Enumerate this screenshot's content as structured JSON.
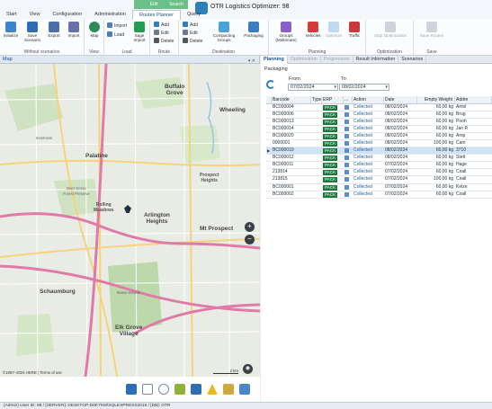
{
  "app": {
    "title": "OTR Logistics Optimizer: 98",
    "context_groups": [
      "Edit",
      "Routes Planner",
      "Search",
      "Query"
    ]
  },
  "tabs": [
    "Start",
    "View",
    "Configuration",
    "Administration",
    "Routes Planner",
    "Query"
  ],
  "active_tab": "Routes Planner",
  "ribbon": {
    "groups": [
      {
        "label": "Without scenarios",
        "buttons": [
          "Initialize",
          "Save Scenario",
          "Export",
          "Import"
        ]
      },
      {
        "label": "View",
        "buttons": [
          "Map"
        ]
      },
      {
        "label": "Load",
        "small": [
          "Import",
          "Load"
        ],
        "buttons": [
          "Sage Import"
        ]
      },
      {
        "label": "Route",
        "small": [
          "Add",
          "Edit",
          "Delete"
        ]
      },
      {
        "label": "Destination",
        "small": [
          "Add",
          "Edit",
          "Delete"
        ],
        "buttons": [
          "Compacting Groups",
          "Packaging"
        ]
      },
      {
        "label": "Planning",
        "buttons": [
          "Groups (Multiroute)",
          "Vehicles",
          "Optimize",
          "Traffic"
        ]
      },
      {
        "label": "Optimization",
        "buttons": [
          "Stop Optimization"
        ]
      },
      {
        "label": "Save",
        "buttons": [
          "Save Routes"
        ]
      }
    ]
  },
  "map": {
    "panel_title": "Map",
    "labels": [
      {
        "text": "Buffalo\nGrove",
        "kind": "big"
      },
      {
        "text": "Wheeling",
        "kind": "big"
      },
      {
        "text": "Inverness",
        "kind": "small"
      },
      {
        "text": "Palatine",
        "kind": "big"
      },
      {
        "text": "Prospect\nHeights",
        "kind": "normal"
      },
      {
        "text": "Rolling\nMeadows",
        "kind": "normal"
      },
      {
        "text": "Arlington\nHeights",
        "kind": "big"
      },
      {
        "text": "Mt Prospect",
        "kind": "big"
      },
      {
        "text": "Schaumburg",
        "kind": "big"
      },
      {
        "text": "Elk Grove\nVillage",
        "kind": "big"
      },
      {
        "text": "Deer Grove\nForest Preserve",
        "kind": "small"
      },
      {
        "text": "Busse Woods",
        "kind": "small"
      }
    ],
    "copyright": "©1987–2024 HERE | Terms of use",
    "scale": "2 km",
    "zoom_in": "+",
    "zoom_out": "−"
  },
  "right": {
    "tabs": [
      "Planning",
      "Optimization",
      "Progression",
      "Result Information",
      "Scenarios"
    ],
    "active_tab": "Planning",
    "section_title": "Packaging",
    "from_label": "From",
    "to_label": "To",
    "from_value": "07/02/2024",
    "to_value": "08/02/2024",
    "columns": [
      "Barcode",
      "Type",
      "ERP",
      "...",
      "Action",
      "Date",
      "Empty Weight",
      "Addre"
    ],
    "rows": [
      {
        "barcode": "BC000004",
        "erp": "PACK",
        "action": "Collected",
        "date": "08/02/2024",
        "weight": "60,00 kg",
        "address": "Amol",
        "selected": false
      },
      {
        "barcode": "BC000006",
        "erp": "PACK",
        "action": "Collected",
        "date": "08/02/2024",
        "weight": "60,00 kg",
        "address": "Brug",
        "selected": false
      },
      {
        "barcode": "BC000013",
        "erp": "PACK",
        "action": "Collected",
        "date": "08/02/2024",
        "weight": "60,00 kg",
        "address": "Pooh",
        "selected": false
      },
      {
        "barcode": "BC000014",
        "erp": "PACK",
        "action": "Collected",
        "date": "08/02/2024",
        "weight": "60,00 kg",
        "address": "Jan R",
        "selected": false
      },
      {
        "barcode": "BC000020",
        "erp": "PACK",
        "action": "Collected",
        "date": "08/02/2024",
        "weight": "60,00 kg",
        "address": "Amp",
        "selected": false
      },
      {
        "barcode": "0000001",
        "erp": "PACK",
        "action": "Collected",
        "date": "08/02/2024",
        "weight": "100,00 kg",
        "address": "Cam",
        "selected": false
      },
      {
        "barcode": "BC000010",
        "erp": "PACK",
        "action": "Collected",
        "date": "08/02/2024",
        "weight": "60,00 kg",
        "address": "3710",
        "selected": true
      },
      {
        "barcode": "BC000012",
        "erp": "PACK",
        "action": "Collected",
        "date": "08/02/2024",
        "weight": "60,00 kg",
        "address": "Stett",
        "selected": false
      },
      {
        "barcode": "BC000011",
        "erp": "PACK",
        "action": "Collected",
        "date": "07/02/2024",
        "weight": "60,00 kg",
        "address": "Hage",
        "selected": false
      },
      {
        "barcode": "213814",
        "erp": "PACK",
        "action": "Collected",
        "date": "07/02/2024",
        "weight": "60,00 kg",
        "address": "Coall",
        "selected": false
      },
      {
        "barcode": "213815",
        "erp": "PACK",
        "action": "Collected",
        "date": "07/02/2024",
        "weight": "100,00 kg",
        "address": "Coall",
        "selected": false
      },
      {
        "barcode": "BC000001",
        "erp": "PACK",
        "action": "Collected",
        "date": "07/02/2024",
        "weight": "60,00 kg",
        "address": "Kelze",
        "selected": false
      },
      {
        "barcode": "BC000002",
        "erp": "PACK",
        "action": "Collected",
        "date": "07/02/2024",
        "weight": "60,00 kg",
        "address": "Coall",
        "selected": false
      }
    ]
  },
  "statusbar": "(Admin)  User ID: 98  /  [SERVER]: DESKTOP-D6K7KM\\SQLEXPRESS2016 / [DB]: OTR"
}
